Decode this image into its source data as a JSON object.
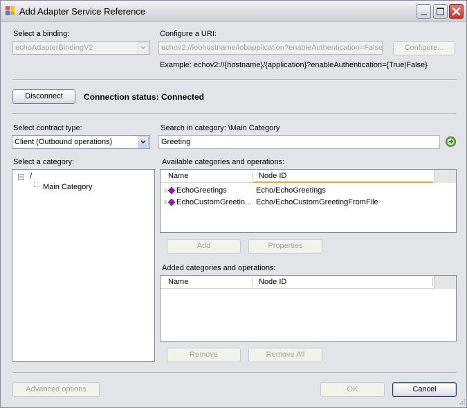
{
  "window": {
    "title": "Add Adapter Service Reference",
    "icon": "app-icon",
    "controls": [
      "minimize-icon",
      "maximize-icon",
      "close-icon"
    ]
  },
  "binding": {
    "label": "Select a binding:",
    "value": "echoAdapterBindingV2",
    "enabled": false
  },
  "uri": {
    "label": "Configure a URI:",
    "value": "echov2://lobhostname/lobapplication?enableAuthentication=False",
    "configure_label": "Configure...",
    "example": "Example: echov2://{hostname}/{application}?enableAuthentication={True|False}"
  },
  "connection": {
    "disconnect_label": "Disconnect",
    "status": "Connection status: Connected"
  },
  "contract": {
    "label": "Select contract type:",
    "value": "Client (Outbound operations)"
  },
  "search": {
    "label": "Search in category: \\Main Category",
    "value": "Greeting",
    "go_icon": "go-arrow-icon"
  },
  "category": {
    "label": "Select a category:",
    "tree": [
      {
        "label": "/",
        "expanded": true,
        "toggle": "minus"
      },
      {
        "label": "Main Category"
      }
    ]
  },
  "available": {
    "label": "Available categories and operations:",
    "columns": [
      "Name",
      "Node ID"
    ],
    "rows": [
      {
        "name": "EchoGreetings",
        "node_id": "Echo/EchoGreetings"
      },
      {
        "name": "EchoCustomGreetin...",
        "node_id": "Echo/EchoCustomGreetingFromFile"
      }
    ],
    "add_label": "Add",
    "properties_label": "Properties"
  },
  "added": {
    "label": "Added categories and operations:",
    "columns": [
      "Name",
      "Node ID"
    ],
    "rows": [],
    "remove_label": "Remove",
    "remove_all_label": "Remove All"
  },
  "footer": {
    "advanced_label": "Advanced options",
    "ok_label": "OK",
    "cancel_label": "Cancel"
  }
}
